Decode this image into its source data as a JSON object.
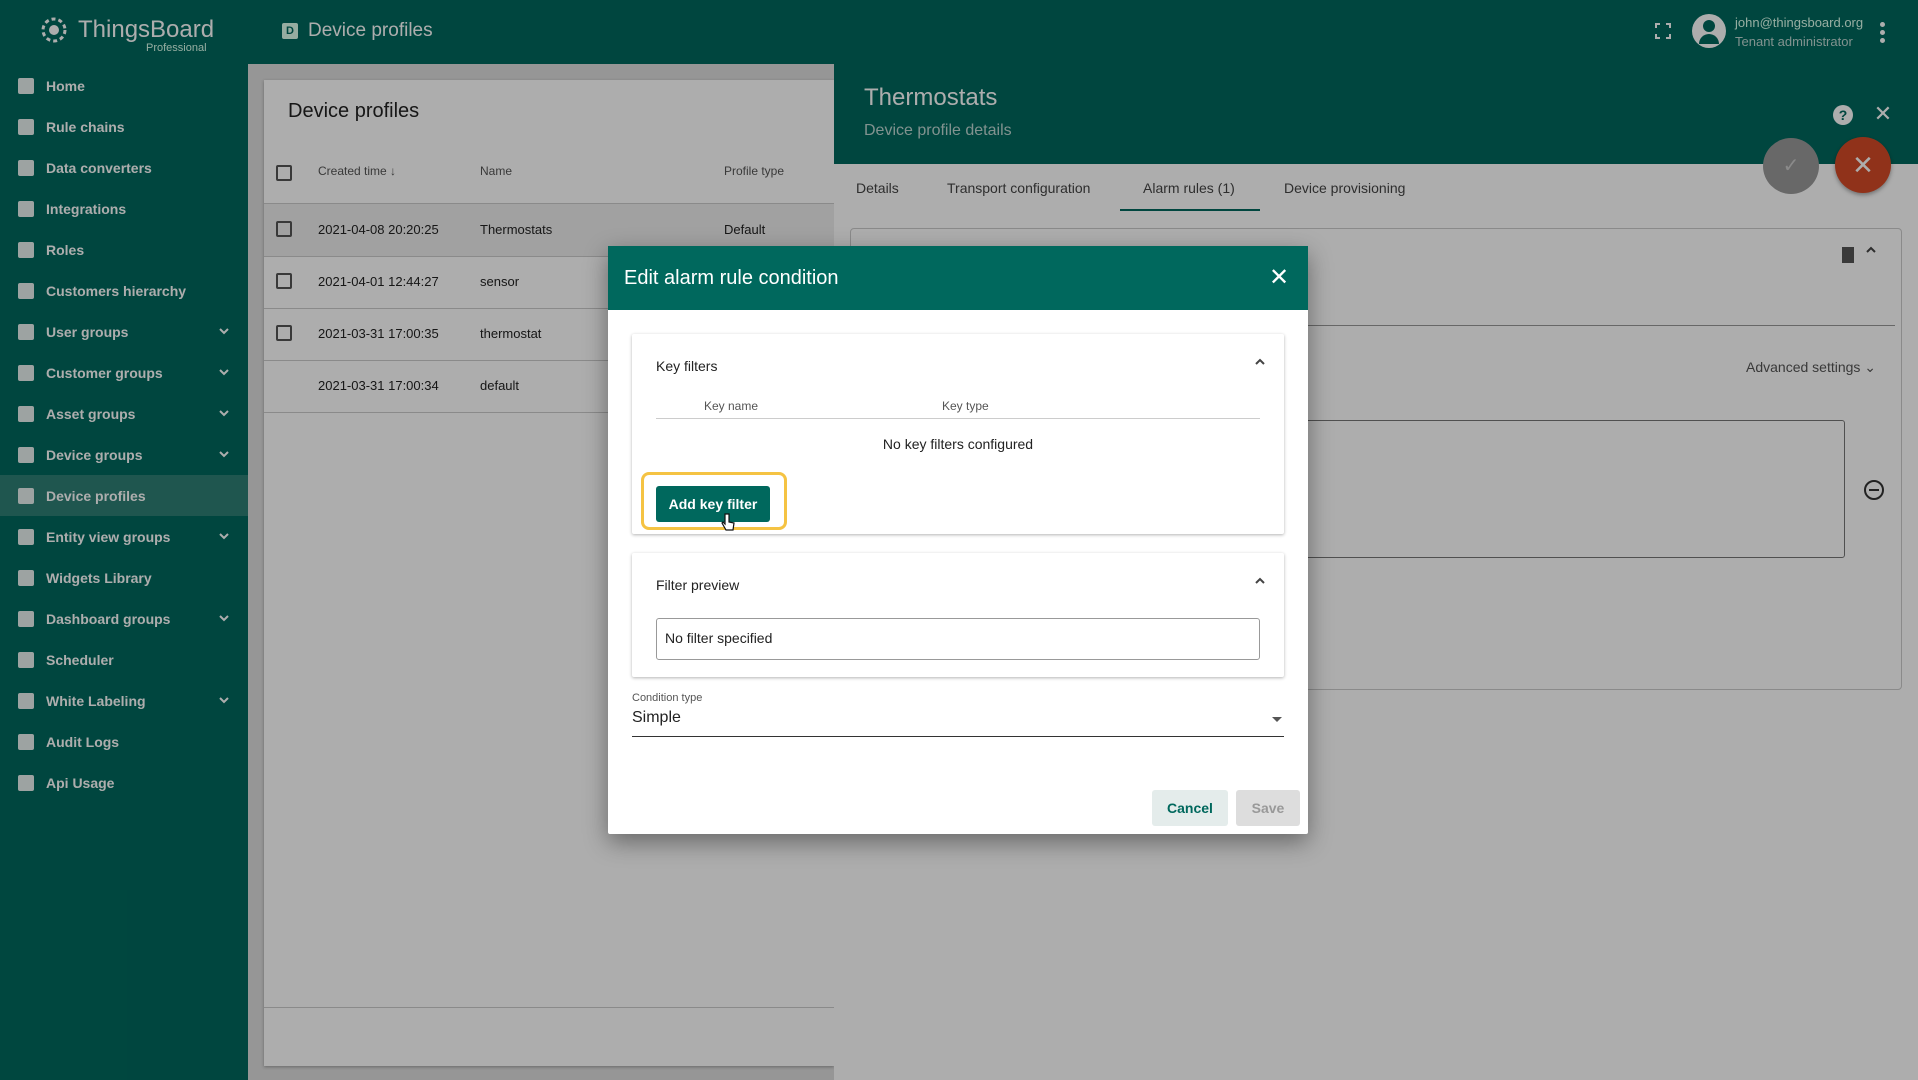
{
  "app": {
    "name": "ThingsBoard",
    "edition": "Professional"
  },
  "topbar": {
    "title": "Device profiles",
    "title_icon_glyph": "D",
    "user_email": "john@thingsboard.org",
    "user_role": "Tenant administrator"
  },
  "sidebar": {
    "items": [
      {
        "label": "Home",
        "icon": "home-icon"
      },
      {
        "label": "Rule chains",
        "icon": "rule-chains-icon"
      },
      {
        "label": "Data converters",
        "icon": "data-converters-icon"
      },
      {
        "label": "Integrations",
        "icon": "integrations-icon"
      },
      {
        "label": "Roles",
        "icon": "roles-icon"
      },
      {
        "label": "Customers hierarchy",
        "icon": "customers-hierarchy-icon"
      },
      {
        "label": "User groups",
        "icon": "user-groups-icon"
      },
      {
        "label": "Customer groups",
        "icon": "customer-groups-icon"
      },
      {
        "label": "Asset groups",
        "icon": "asset-groups-icon"
      },
      {
        "label": "Device groups",
        "icon": "device-groups-icon"
      },
      {
        "label": "Device profiles",
        "icon": "device-profiles-icon"
      },
      {
        "label": "Entity view groups",
        "icon": "entity-view-groups-icon"
      },
      {
        "label": "Widgets Library",
        "icon": "widgets-library-icon"
      },
      {
        "label": "Dashboard groups",
        "icon": "dashboard-groups-icon"
      },
      {
        "label": "Scheduler",
        "icon": "scheduler-icon"
      },
      {
        "label": "White Labeling",
        "icon": "white-labeling-icon"
      },
      {
        "label": "Audit Logs",
        "icon": "audit-logs-icon"
      },
      {
        "label": "Api Usage",
        "icon": "api-usage-icon"
      }
    ]
  },
  "profiles_table": {
    "title": "Device profiles",
    "columns": [
      "Created time",
      "Name",
      "Profile type"
    ],
    "rows": [
      {
        "created": "2021-04-08 20:20:25",
        "name": "Thermostats",
        "type": "Default"
      },
      {
        "created": "2021-04-01 12:44:27",
        "name": "sensor",
        "type": ""
      },
      {
        "created": "2021-03-31 17:00:35",
        "name": "thermostat",
        "type": ""
      },
      {
        "created": "2021-03-31 17:00:34",
        "name": "default",
        "type": ""
      }
    ]
  },
  "details": {
    "title": "Thermostats",
    "subtitle": "Device profile details",
    "tabs": [
      "Details",
      "Transport configuration",
      "Alarm rules (1)",
      "Device provisioning"
    ],
    "advanced_settings": "Advanced settings"
  },
  "dialog": {
    "title": "Edit alarm rule condition",
    "key_filters": {
      "title": "Key filters",
      "col_key_name": "Key name",
      "col_key_type": "Key type",
      "empty": "No key filters configured",
      "add_button": "Add key filter"
    },
    "filter_preview": {
      "title": "Filter preview",
      "value": "No filter specified"
    },
    "condition_type": {
      "label": "Condition type",
      "value": "Simple"
    },
    "cancel": "Cancel",
    "save": "Save"
  },
  "colors": {
    "primary": "#00685d",
    "accent": "#d54b27",
    "highlight": "#f5c343"
  }
}
